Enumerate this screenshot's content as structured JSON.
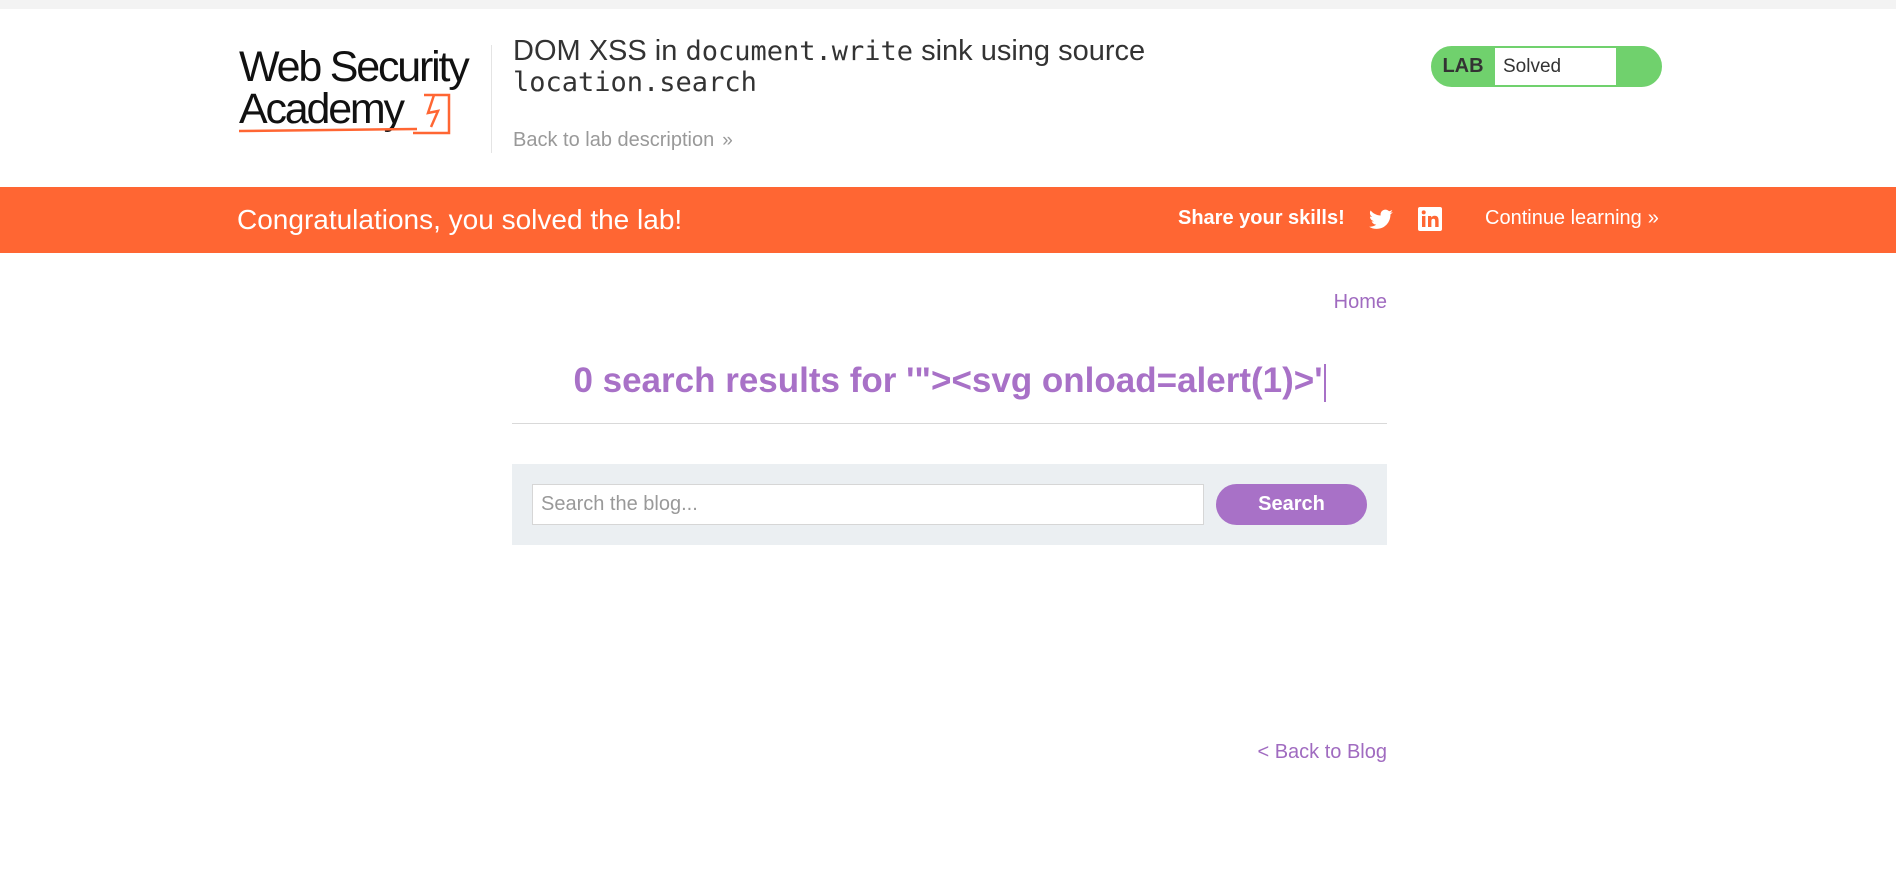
{
  "logo": {
    "line1": "Web Security",
    "line2": "Academy"
  },
  "header": {
    "title_part1": "DOM XSS in ",
    "title_code1": "document.write",
    "title_part2": " sink using source ",
    "title_code2": "location.search",
    "back_link": "Back to lab description",
    "back_chevron": "»"
  },
  "lab_status": {
    "tag": "LAB",
    "value": "Solved",
    "color": "#70d16d"
  },
  "banner": {
    "message": "Congratulations, you solved the lab!",
    "share_label": "Share your skills!",
    "twitter_icon": "twitter-icon",
    "linkedin_icon": "linkedin-icon",
    "continue_label": "Continue learning",
    "continue_chevron": "»",
    "color": "#ff6633"
  },
  "nav": {
    "home": "Home"
  },
  "search": {
    "results_text": "0 search results for '\"><svg onload=alert(1)>'",
    "placeholder": "Search the blog...",
    "button_label": "Search",
    "accent": "#a871c7"
  },
  "footer": {
    "back_blog": "< Back to Blog"
  }
}
